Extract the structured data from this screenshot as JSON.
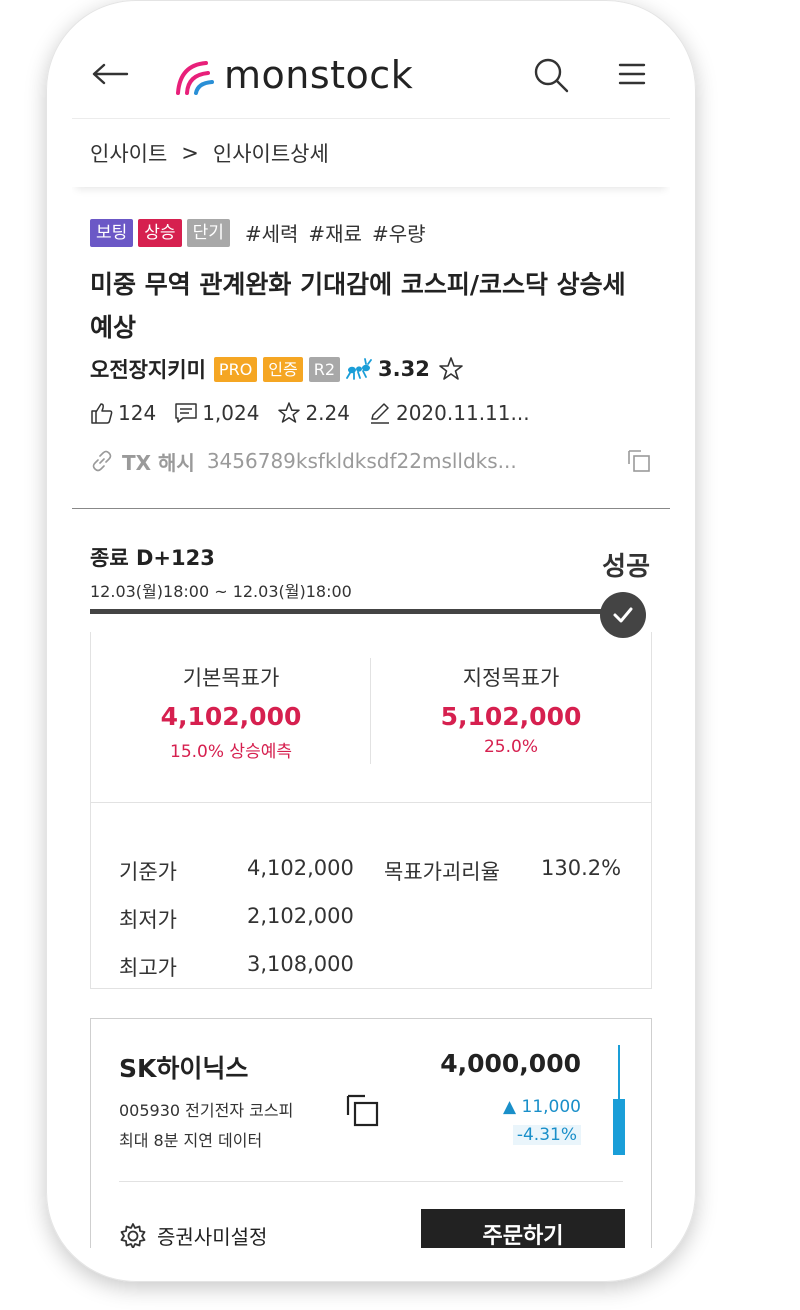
{
  "header": {
    "logo_text": "monstock",
    "logo_colors": [
      "#e8207a",
      "#2a8fd6"
    ]
  },
  "breadcrumb": {
    "parent": "인사이트",
    "separator": ">",
    "current": "인사이트상세"
  },
  "insight": {
    "badges": [
      {
        "label": "보팅",
        "color": "#6b58c6"
      },
      {
        "label": "상승",
        "color": "#d6204f"
      },
      {
        "label": "단기",
        "color": "#a8a8a8"
      }
    ],
    "hashtags": [
      "#세력",
      "#재료",
      "#우량"
    ],
    "title": "미중 무역 관계완화 기대감에 코스피/코스닥 상승세 예상",
    "author": {
      "name": "오전장지키미",
      "badges": [
        {
          "label": "PRO",
          "color": "#f5a623"
        },
        {
          "label": "인증",
          "color": "#f5a623"
        },
        {
          "label": "R2",
          "color": "#a8a8a8"
        }
      ],
      "rank_icon": "ant-icon",
      "score": "3.32",
      "favorite_icon": "star-outline-icon"
    },
    "meta": {
      "likes": "124",
      "comments": "1,024",
      "rating": "2.24",
      "date": "2020.11.11..."
    },
    "tx": {
      "label": "TX 해시",
      "hash": "3456789ksfkldksdf22mslldks..."
    }
  },
  "prediction": {
    "end_label": "종료 D+123",
    "period": "12.03(월)18:00 ~ 12.03(월)18:00",
    "result": "성공",
    "progress": 1.0,
    "base_target": {
      "label": "기본목표가",
      "value": "4,102,000",
      "sub": "15.0% 상승예측"
    },
    "custom_target": {
      "label": "지정목표가",
      "value": "5,102,000",
      "sub": "25.0%"
    },
    "stats": {
      "base_label": "기준가",
      "base_value": "4,102,000",
      "gap_label": "목표가괴리율",
      "gap_value": "130.2%",
      "low_label": "최저가",
      "low_value": "2,102,000",
      "high_label": "최고가",
      "high_value": "3,108,000"
    }
  },
  "stock": {
    "name": "SK하이닉스",
    "info": "005930 전기전자 코스피",
    "delay": "최대 8분 지연 데이터",
    "price": "4,000,000",
    "change": "▲ 11,000",
    "change_pct": "-4.31%",
    "settings_label": "증권사미설정",
    "order_label": "주문하기"
  }
}
